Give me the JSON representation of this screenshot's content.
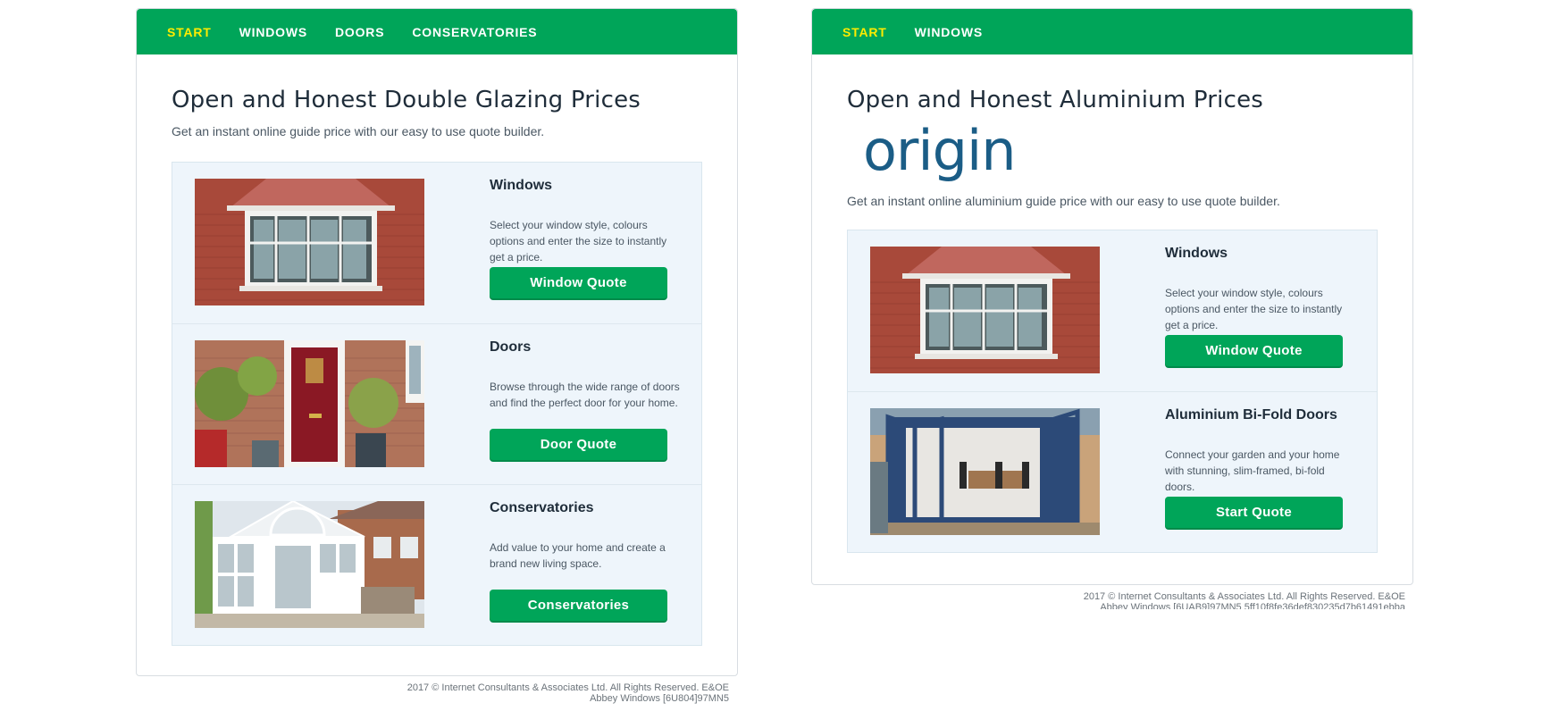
{
  "left": {
    "nav": [
      "START",
      "WINDOWS",
      "DOORS",
      "CONSERVATORIES"
    ],
    "title": "Open and Honest Double Glazing Prices",
    "intro": "Get an instant online guide price with our easy to use quote builder.",
    "cards": [
      {
        "title": "Windows",
        "desc": "Select your window style, colours options and enter the size to instantly get a price.",
        "button": "Window Quote",
        "image": "bay-window-photo"
      },
      {
        "title": "Doors",
        "desc": "Browse through the wide range of doors and find the perfect door for your home.",
        "button": "Door Quote",
        "image": "red-front-door-photo"
      },
      {
        "title": "Conservatories",
        "desc": "Add value to your home and create a brand new living space.",
        "button": "Conservatories",
        "image": "conservatory-photo"
      }
    ],
    "footer": {
      "line1": "2017 © Internet Consultants & Associates Ltd. All Rights Reserved. E&OE",
      "line2": "Abbey Windows [6U804]97MN5"
    }
  },
  "right": {
    "nav": [
      "START",
      "WINDOWS"
    ],
    "title": "Open and Honest Aluminium Prices",
    "logo": "origin",
    "intro": "Get an instant online aluminium guide price with our easy to use quote builder.",
    "cards": [
      {
        "title": "Windows",
        "desc": "Select your window style, colours options and enter the size to instantly get a price.",
        "button": "Window Quote",
        "image": "bay-window-photo"
      },
      {
        "title": "Aluminium Bi-Fold Doors",
        "desc": "Connect your garden and your home with stunning, slim-framed, bi-fold doors.",
        "button": "Start Quote",
        "image": "bifold-doors-photo"
      }
    ],
    "footer": {
      "line1": "2017 © Internet Consultants & Associates Ltd. All Rights Reserved. E&OE",
      "line2": "Abbey Windows [6UAB9]97MN5 5ff10f8fe36def830235d7b61491ebba"
    }
  },
  "colors": {
    "brand_green": "#00a559",
    "nav_active": "#ffec00",
    "card_bg": "#eef5fb",
    "logo_blue": "#1b5d86"
  }
}
